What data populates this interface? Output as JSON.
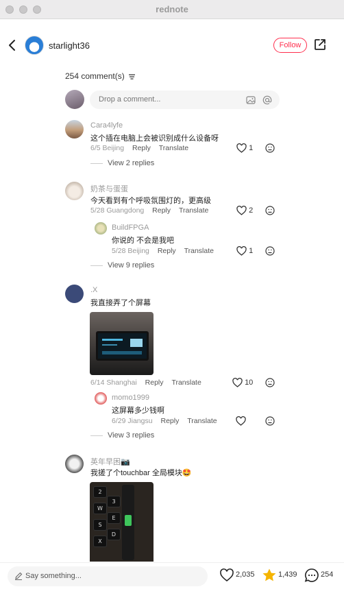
{
  "window": {
    "title": "rednote"
  },
  "header": {
    "author": "starlight36",
    "follow_label": "Follow"
  },
  "comments_header": {
    "count_label": "254 comment(s)"
  },
  "comment_input": {
    "placeholder": "Drop a comment..."
  },
  "comments": [
    {
      "user": "Cara4lyfe",
      "text": "这个插在电脑上会被识别成什么设备呀",
      "date": "6/5",
      "location": "Beijing",
      "likes": "1",
      "view_replies": "View 2 replies"
    },
    {
      "user": "奶茶与蛋蛋",
      "text": "今天看到有个呼吸氛围灯的，更高级",
      "date": "5/28",
      "location": "Guangdong",
      "likes": "2",
      "reply": {
        "user": "BuildFPGA",
        "text": "你说的 不会是我吧",
        "date": "5/28",
        "location": "Beijing",
        "likes": "1"
      },
      "view_replies": "View 9 replies"
    },
    {
      "user": ".X",
      "text": "我直接弄了个屏幕",
      "date": "6/14",
      "location": "Shanghai",
      "likes": "10",
      "reply": {
        "user": "momo1999",
        "text": "这屏幕多少钱啊",
        "date": "6/29",
        "location": "Jiangsu",
        "likes": ""
      },
      "view_replies": "View 3 replies"
    },
    {
      "user": "英年早困📷",
      "text": "我搓了个touchbar 全局模块🤩"
    }
  ],
  "actions": {
    "reply": "Reply",
    "translate": "Translate"
  },
  "photo2_keys": [
    "2",
    "W",
    "S",
    "X",
    "3",
    "E",
    "D"
  ],
  "bottom": {
    "placeholder": "Say something...",
    "likes": "2,035",
    "stars": "1,439",
    "comments": "254"
  },
  "colors": {
    "accent": "#ff2e4d",
    "star": "#f5b400"
  }
}
